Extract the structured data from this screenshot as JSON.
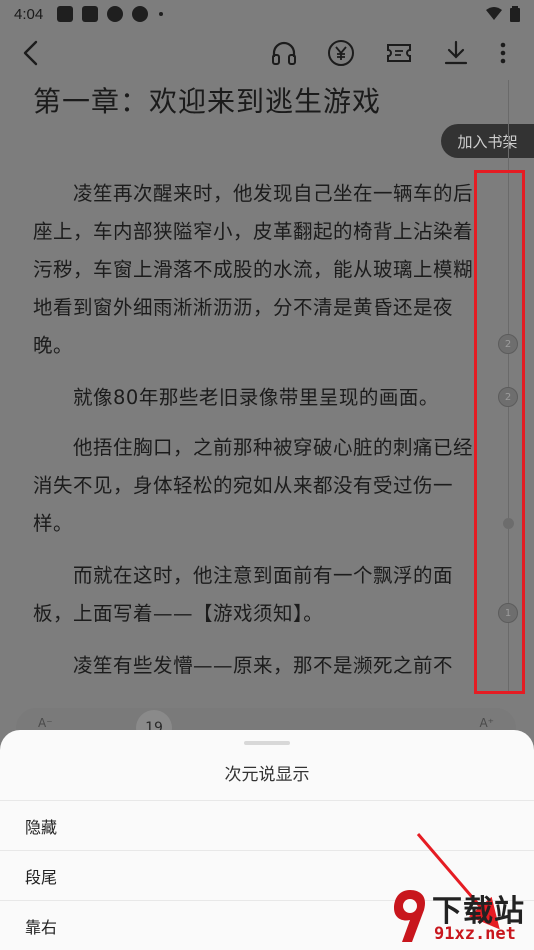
{
  "status_bar": {
    "time": "4:04"
  },
  "reader": {
    "chapter_title": "第一章：欢迎来到逃生游戏",
    "bookshelf_button": "加入书架",
    "paragraphs": [
      "　　凌笙再次醒来时，他发现自己坐在一辆车的后座上，车内部狭隘窄小，皮革翻起的椅背上沾染着污秽，车窗上滑落不成股的水流，能从玻璃上模糊地看到窗外细雨淅淅沥沥，分不清是黄昏还是夜晚。",
      "　　就像80年那些老旧录像带里呈现的画面。",
      "　　他捂住胸口，之前那种被穿破心脏的刺痛已经消失不见，身体轻松的宛如从来都没有受过伤一样。",
      "　　而就在这时，他注意到面前有一个飘浮的面板，上面写着——【游戏须知】。",
      "　　凌笙有些发懵——原来，那不是濒死之前不"
    ],
    "comment_badges": [
      "2",
      "2",
      "1"
    ],
    "font_bar": {
      "small_label": "A⁻",
      "large_label": "A⁺",
      "size_value": "19"
    }
  },
  "sheet": {
    "title": "次元说显示",
    "options": [
      "隐藏",
      "段尾",
      "靠右"
    ]
  },
  "watermark": {
    "title": "下载站",
    "subtitle": "91xz.net"
  },
  "colors": {
    "annotation_red": "#e51c23",
    "dim_overlay": "#7d7d7d",
    "sheet_bg": "#fafafa"
  },
  "icons": [
    "back-arrow-icon",
    "headphones-icon",
    "yen-coin-icon",
    "ticket-icon",
    "download-icon",
    "more-vertical-icon"
  ]
}
